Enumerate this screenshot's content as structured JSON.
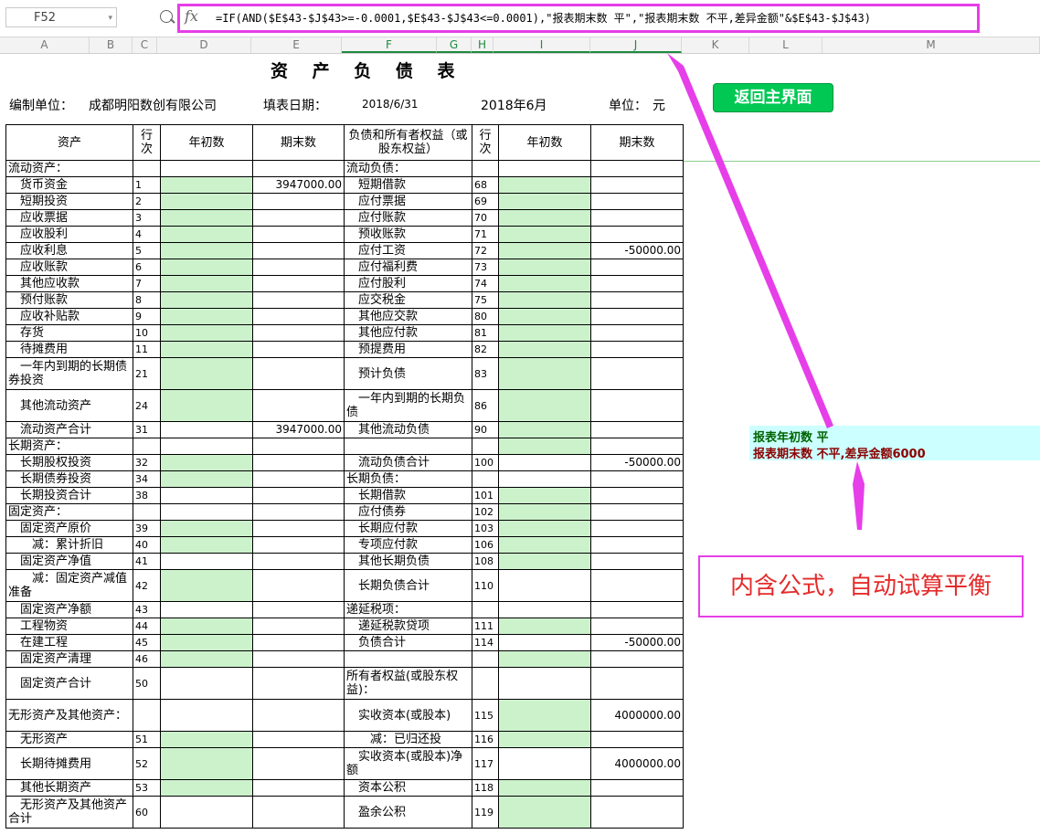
{
  "formula_bar": {
    "cell_ref": "F52",
    "formula": "=IF(AND($E$43-$J$43>=-0.0001,$E$43-$J$43<=0.0001),\"报表期末数 平\",\"报表期末数 不平,差异金额\"&$E$43-$J$43)"
  },
  "columns": [
    "A",
    "B",
    "C",
    "D",
    "E",
    "F",
    "G",
    "H",
    "I",
    "J",
    "K",
    "L",
    "M"
  ],
  "sheet": {
    "title": "资 产 负 债 表",
    "unit_label": "编制单位：",
    "unit_name": "成都明阳数创有限公司",
    "date_label": "填表日期：",
    "date_value": "2018/6/31",
    "period": "2018年6月",
    "currency_label": "单位：",
    "currency": "元",
    "headers": [
      "资产",
      "行次",
      "年初数",
      "期末数",
      "负债和所有者权益（或股东权益）",
      "行次",
      "年初数",
      "期末数"
    ],
    "rows": [
      {
        "a": "流动资产：",
        "ar": "",
        "ad": "",
        "ae": "",
        "l": "流动负债：",
        "lr": "",
        "ld": "",
        "le": "",
        "ag": false,
        "lg": false
      },
      {
        "a": "　货币资金",
        "ar": "1",
        "ad": "",
        "ae": "3947000.00",
        "l": "　短期借款",
        "lr": "68",
        "ld": "",
        "le": "",
        "ag": true,
        "lg": true
      },
      {
        "a": "　短期投资",
        "ar": "2",
        "ad": "",
        "ae": "",
        "l": "　应付票据",
        "lr": "69",
        "ld": "",
        "le": "",
        "ag": true,
        "lg": true
      },
      {
        "a": "　应收票据",
        "ar": "3",
        "ad": "",
        "ae": "",
        "l": "　应付账款",
        "lr": "70",
        "ld": "",
        "le": "",
        "ag": true,
        "lg": true
      },
      {
        "a": "　应收股利",
        "ar": "4",
        "ad": "",
        "ae": "",
        "l": "　预收账款",
        "lr": "71",
        "ld": "",
        "le": "",
        "ag": true,
        "lg": true
      },
      {
        "a": "　应收利息",
        "ar": "5",
        "ad": "",
        "ae": "",
        "l": "　应付工资",
        "lr": "72",
        "ld": "",
        "le": "-50000.00",
        "ag": true,
        "lg": true
      },
      {
        "a": "　应收账款",
        "ar": "6",
        "ad": "",
        "ae": "",
        "l": "　应付福利费",
        "lr": "73",
        "ld": "",
        "le": "",
        "ag": true,
        "lg": true
      },
      {
        "a": "　其他应收款",
        "ar": "7",
        "ad": "",
        "ae": "",
        "l": "　应付股利",
        "lr": "74",
        "ld": "",
        "le": "",
        "ag": true,
        "lg": true
      },
      {
        "a": "　预付账款",
        "ar": "8",
        "ad": "",
        "ae": "",
        "l": "　应交税金",
        "lr": "75",
        "ld": "",
        "le": "",
        "ag": true,
        "lg": true
      },
      {
        "a": "　应收补贴款",
        "ar": "9",
        "ad": "",
        "ae": "",
        "l": "　其他应交款",
        "lr": "80",
        "ld": "",
        "le": "",
        "ag": true,
        "lg": true
      },
      {
        "a": "　存货",
        "ar": "10",
        "ad": "",
        "ae": "",
        "l": "　其他应付款",
        "lr": "81",
        "ld": "",
        "le": "",
        "ag": true,
        "lg": true
      },
      {
        "a": "　待摊费用",
        "ar": "11",
        "ad": "",
        "ae": "",
        "l": "　预提费用",
        "lr": "82",
        "ld": "",
        "le": "",
        "ag": true,
        "lg": true
      },
      {
        "a": "　一年内到期的长期债券投资",
        "ar": "21",
        "ad": "",
        "ae": "",
        "l": "　预计负债",
        "lr": "83",
        "ld": "",
        "le": "",
        "ag": true,
        "lg": true,
        "tall": true
      },
      {
        "a": "　其他流动资产",
        "ar": "24",
        "ad": "",
        "ae": "",
        "l": "　一年内到期的长期负债",
        "lr": "86",
        "ld": "",
        "le": "",
        "ag": true,
        "lg": true,
        "tall": true
      },
      {
        "a": "　流动资产合计",
        "ar": "31",
        "ad": "",
        "ae": "3947000.00",
        "l": "　其他流动负债",
        "lr": "90",
        "ld": "",
        "le": "",
        "ag": false,
        "lg": true
      },
      {
        "a": "长期资产：",
        "ar": "",
        "ad": "",
        "ae": "",
        "l": "",
        "lr": "",
        "ld": "",
        "le": "",
        "ag": false,
        "lg": true
      },
      {
        "a": "　长期股权投资",
        "ar": "32",
        "ad": "",
        "ae": "",
        "l": "　流动负债合计",
        "lr": "100",
        "ld": "",
        "le": "-50000.00",
        "ag": true,
        "lg": false
      },
      {
        "a": "　长期债券投资",
        "ar": "34",
        "ad": "",
        "ae": "",
        "l": "长期负债：",
        "lr": "",
        "ld": "",
        "le": "",
        "ag": true,
        "lg": false
      },
      {
        "a": "　长期投资合计",
        "ar": "38",
        "ad": "",
        "ae": "",
        "l": "　长期借款",
        "lr": "101",
        "ld": "",
        "le": "",
        "ag": false,
        "lg": true
      },
      {
        "a": "固定资产：",
        "ar": "",
        "ad": "",
        "ae": "",
        "l": "　应付债券",
        "lr": "102",
        "ld": "",
        "le": "",
        "ag": false,
        "lg": true
      },
      {
        "a": "　固定资产原价",
        "ar": "39",
        "ad": "",
        "ae": "",
        "l": "　长期应付款",
        "lr": "103",
        "ld": "",
        "le": "",
        "ag": true,
        "lg": true
      },
      {
        "a": "　　减：累计折旧",
        "ar": "40",
        "ad": "",
        "ae": "",
        "l": "　专项应付款",
        "lr": "106",
        "ld": "",
        "le": "",
        "ag": true,
        "lg": true
      },
      {
        "a": "　固定资产净值",
        "ar": "41",
        "ad": "",
        "ae": "",
        "l": "　其他长期负债",
        "lr": "108",
        "ld": "",
        "le": "",
        "ag": false,
        "lg": true
      },
      {
        "a": "　　减：固定资产减值准备",
        "ar": "42",
        "ad": "",
        "ae": "",
        "l": "　长期负债合计",
        "lr": "110",
        "ld": "",
        "le": "",
        "ag": true,
        "lg": false,
        "tall": true
      },
      {
        "a": "　固定资产净额",
        "ar": "43",
        "ad": "",
        "ae": "",
        "l": "递延税项：",
        "lr": "",
        "ld": "",
        "le": "",
        "ag": false,
        "lg": false
      },
      {
        "a": "　工程物资",
        "ar": "44",
        "ad": "",
        "ae": "",
        "l": "　递延税款贷项",
        "lr": "111",
        "ld": "",
        "le": "",
        "ag": true,
        "lg": true
      },
      {
        "a": "　在建工程",
        "ar": "45",
        "ad": "",
        "ae": "",
        "l": "　负债合计",
        "lr": "114",
        "ld": "",
        "le": "-50000.00",
        "ag": true,
        "lg": false
      },
      {
        "a": "　固定资产清理",
        "ar": "46",
        "ad": "",
        "ae": "",
        "l": "",
        "lr": "",
        "ld": "",
        "le": "",
        "ag": true,
        "lg": true
      },
      {
        "a": "　固定资产合计",
        "ar": "50",
        "ad": "",
        "ae": "",
        "l": "所有者权益(或股东权益)：",
        "lr": "",
        "ld": "",
        "le": "",
        "ag": false,
        "lg": false,
        "tall": true
      },
      {
        "a": "无形资产及其他资产：",
        "ar": "",
        "ad": "",
        "ae": "",
        "l": "　实收资本(或股本)",
        "lr": "115",
        "ld": "",
        "le": "4000000.00",
        "ag": false,
        "lg": true,
        "tall": true
      },
      {
        "a": "　无形资产",
        "ar": "51",
        "ad": "",
        "ae": "",
        "l": "　　减：已归还投",
        "lr": "116",
        "ld": "",
        "le": "",
        "ag": true,
        "lg": true
      },
      {
        "a": "　长期待摊费用",
        "ar": "52",
        "ad": "",
        "ae": "",
        "l": "　实收资本(或股本)净额",
        "lr": "117",
        "ld": "",
        "le": "4000000.00",
        "ag": true,
        "lg": false,
        "tall": true
      },
      {
        "a": "　其他长期资产",
        "ar": "53",
        "ad": "",
        "ae": "",
        "l": "　资本公积",
        "lr": "118",
        "ld": "",
        "le": "",
        "ag": true,
        "lg": true
      },
      {
        "a": "　无形资产及其他资产合计",
        "ar": "60",
        "ad": "",
        "ae": "",
        "l": "　盈余公积",
        "lr": "119",
        "ld": "",
        "le": "",
        "ag": false,
        "lg": true,
        "tall": true
      }
    ]
  },
  "button_main": "返回主界面",
  "checks": {
    "begin": "报表年初数 平",
    "end": "报表期末数 不平,差异金额6000"
  },
  "annotation": "内含公式，自动试算平衡",
  "colors": {
    "highlight_border": "#e63ee8",
    "input_cell": "#ccf2cc",
    "check_bg": "#ccffff",
    "button_bg": "#00c853",
    "check_begin_text": "#006400",
    "check_end_text": "#8b0000",
    "annotation_text": "#e52b2b"
  }
}
